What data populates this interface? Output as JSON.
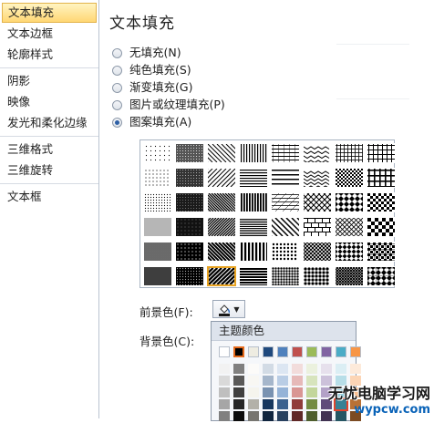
{
  "nav": {
    "groups": [
      [
        "文本填充",
        "文本边框",
        "轮廓样式"
      ],
      [
        "阴影",
        "映像",
        "发光和柔化边缘"
      ],
      [
        "三维格式",
        "三维旋转"
      ],
      [
        "文本框"
      ]
    ],
    "selected": "文本填充"
  },
  "main": {
    "title": "文本填充",
    "options": [
      {
        "label": "无填充(N)",
        "checked": false
      },
      {
        "label": "纯色填充(S)",
        "checked": false
      },
      {
        "label": "渐变填充(G)",
        "checked": false
      },
      {
        "label": "图片或纹理填充(P)",
        "checked": false
      },
      {
        "label": "图案填充(A)",
        "checked": true
      }
    ]
  },
  "pattern_grid": {
    "rows": 6,
    "cols": 8,
    "selected": [
      5,
      2
    ]
  },
  "foreground": {
    "label": "前景色(F):",
    "icon": "paint-bucket-icon"
  },
  "background": {
    "label": "背景色(C):"
  },
  "theme_colors": {
    "title": "主题颜色",
    "swatches": [
      "#ffffff",
      "#000000",
      "#eeece1",
      "#1f497d",
      "#4f81bd",
      "#c0504d",
      "#9bbb59",
      "#8064a2",
      "#4bacc6",
      "#f79646"
    ],
    "selected_index": 1
  },
  "watermark": {
    "text": "无忧电脑学习网",
    "url": "wypcw.com"
  }
}
